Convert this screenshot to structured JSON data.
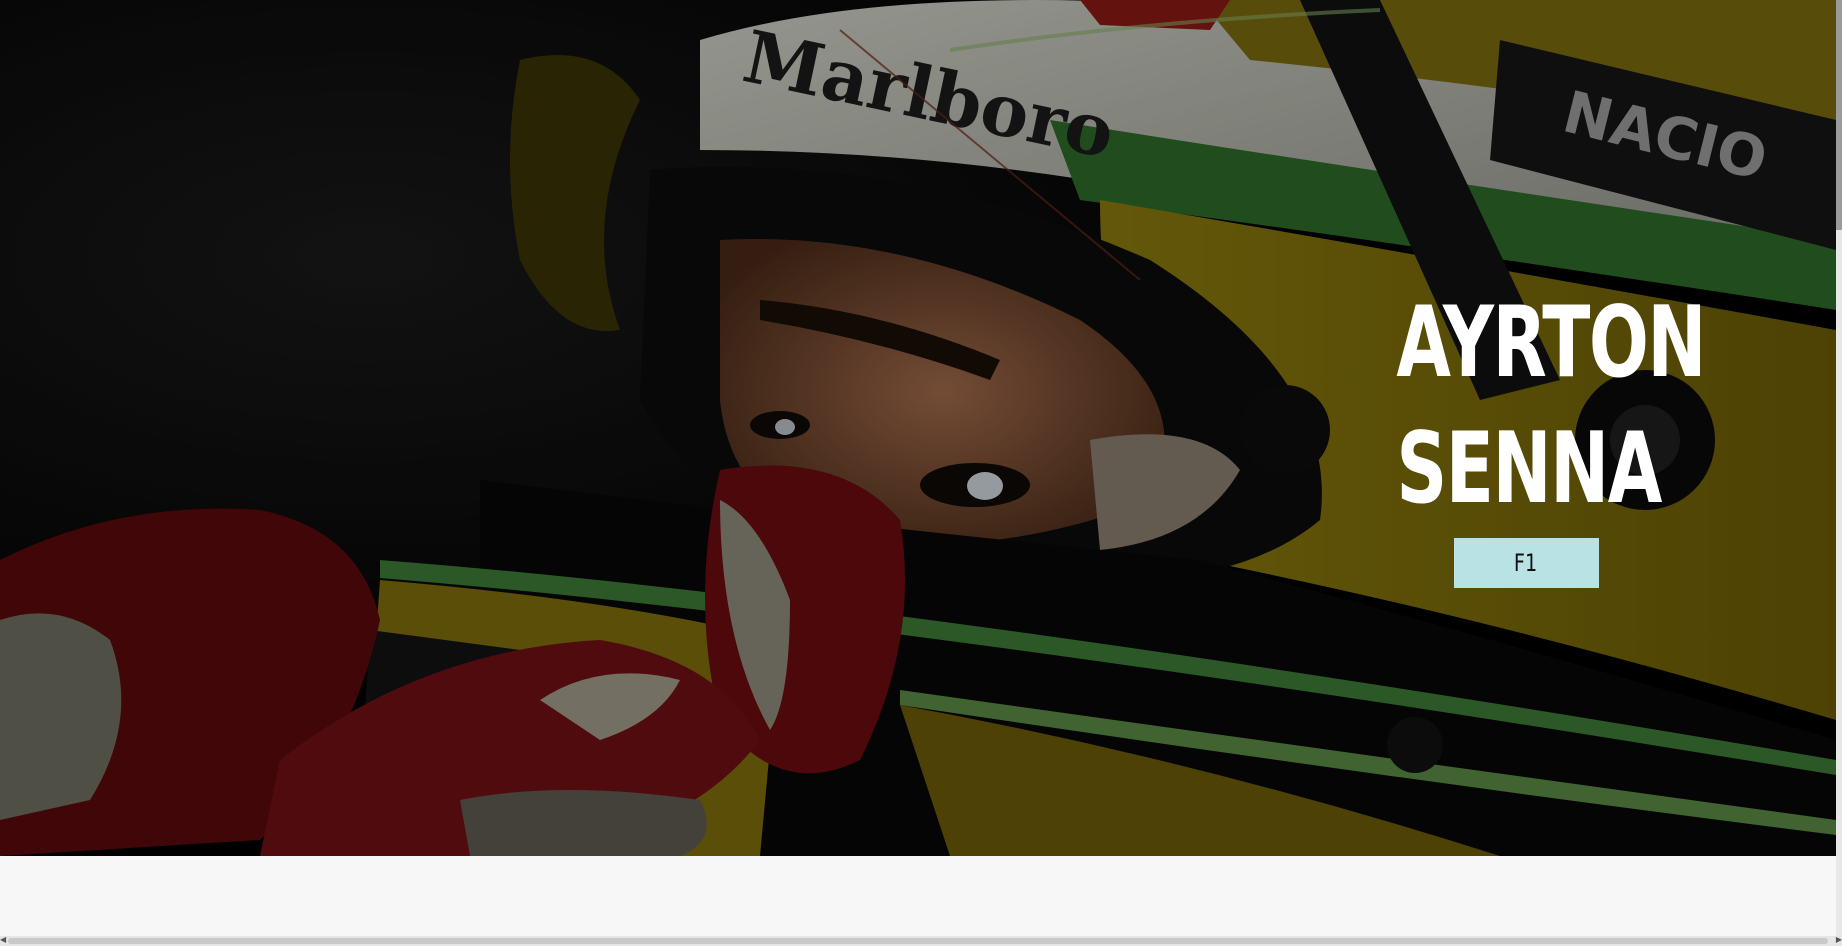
{
  "hero": {
    "title_line1": "AYRTON",
    "title_line2": "SENNA",
    "tag_label": "F1",
    "tag_color": "#b8e2e3"
  },
  "scrollbars": {
    "horizontal_left_icon": "arrow-left-icon",
    "horizontal_right_icon": "arrow-right-icon"
  }
}
